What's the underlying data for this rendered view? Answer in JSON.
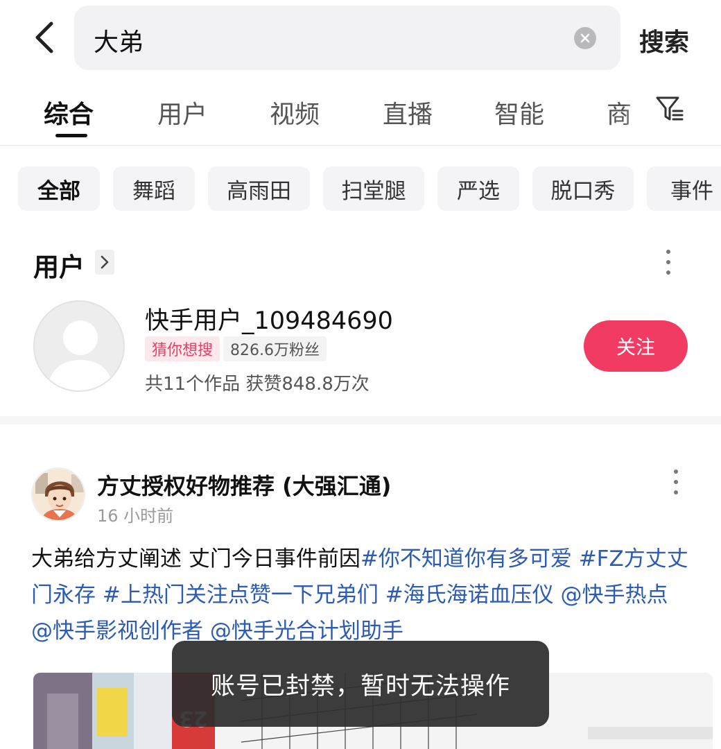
{
  "search": {
    "query": "大弟",
    "submit_label": "搜索"
  },
  "tabs": [
    {
      "label": "综合",
      "active": true
    },
    {
      "label": "用户"
    },
    {
      "label": "视频"
    },
    {
      "label": "直播"
    },
    {
      "label": "智能"
    },
    {
      "label": "商"
    }
  ],
  "chips": [
    {
      "label": "全部",
      "active": true
    },
    {
      "label": "舞蹈"
    },
    {
      "label": "高雨田"
    },
    {
      "label": "扫堂腿"
    },
    {
      "label": "严选"
    },
    {
      "label": "脱口秀"
    },
    {
      "label": "事件"
    }
  ],
  "user_section": {
    "title": "用户",
    "user": {
      "name": "快手用户_109484690",
      "tag_guess": "猜你想搜",
      "fans": "826.6万粉丝",
      "stats": "共11个作品 获赞848.8万次",
      "follow_label": "关注"
    }
  },
  "post": {
    "author": "方丈授权好物推荐 (大强汇通)",
    "time": "16 小时前",
    "text_plain": "大弟给方丈阐述 丈门今日事件前因",
    "tag1": "#你不知道你有多可爱",
    "tag2": "#FZ方丈丈门永存",
    "tag3": "#上热门关注点赞一下兄弟们",
    "tag4": "#海氏海诺血压仪",
    "mention1": "@快手热点",
    "mention2": "@快手影视创作者",
    "mention3": "@快手光合计划助手",
    "jersey_number": "23"
  },
  "toast": {
    "message": "账号已封禁，暂时无法操作"
  },
  "colors": {
    "accent": "#f23b63",
    "link": "#2b5bb5",
    "tag_guess_bg": "#fde8ec"
  }
}
